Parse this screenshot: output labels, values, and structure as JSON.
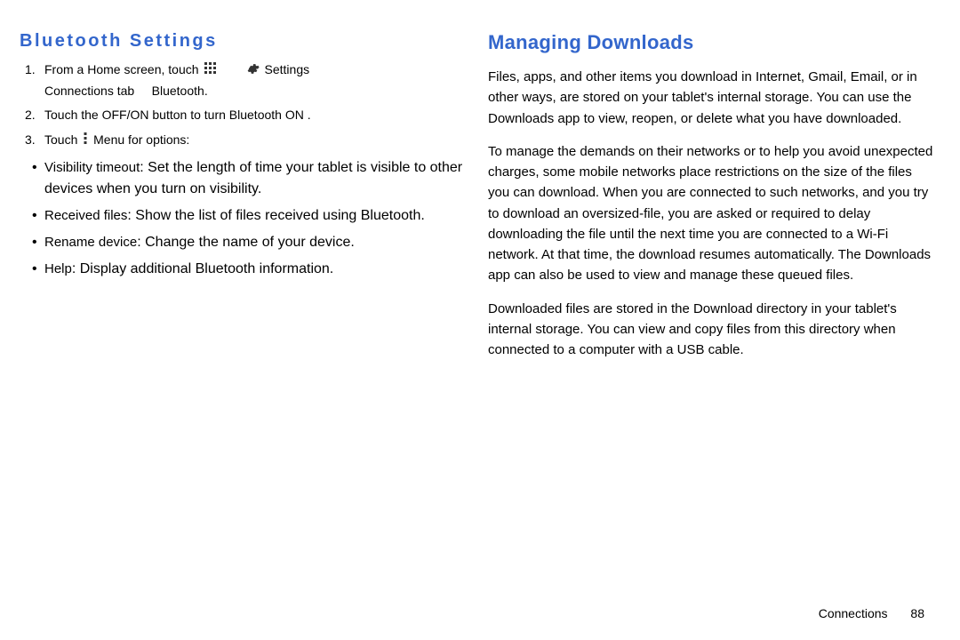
{
  "left": {
    "heading": "Bluetooth Settings",
    "step1_a": "From a Home screen, touch",
    "step1_settings": "Settings",
    "step1_conn_tab": "Connections",
    "step1_tab_word": "tab",
    "step1_bt": "Bluetooth",
    "step2_a": "Touch the ",
    "step2_btn": "OFF/ON",
    "step2_b": " button to turn Bluetooth ON .",
    "step3_a": "Touch ",
    "step3_menu": "Menu",
    "step3_b": " for options:",
    "b1_lbl": "Visibility timeout",
    "b1_txt": ": Set the length of time your tablet is visible to other devices when you turn on visibility.",
    "b2_lbl": "Received files",
    "b2_txt": ": Show the list of files received using Bluetooth.",
    "b3_lbl": "Rename device",
    "b3_txt": ": Change the name of your device.",
    "b4_lbl": "Help",
    "b4_txt": ": Display additional Bluetooth information."
  },
  "right": {
    "heading": "Managing Downloads",
    "p1": "Files, apps, and other items you download in Internet, Gmail, Email, or in other ways, are stored on your tablet's internal storage. You can use the Downloads app to view, reopen, or delete what you have downloaded.",
    "p2": "To manage the demands on their networks or to help you avoid unexpected charges, some mobile networks place restrictions on the size of the files you can download. When you are connected to such networks, and you try to download an oversized-file, you are asked or required to delay downloading the file until the next time you are connected to a Wi-Fi network. At that time, the download resumes automatically. The Downloads app can also be used to view and manage these queued files.",
    "p3": "Downloaded files are stored in the Download directory in your tablet's internal storage. You can view and copy files from this directory when connected to a computer with a USB cable."
  },
  "footer": {
    "section": "Connections",
    "page": "88"
  }
}
